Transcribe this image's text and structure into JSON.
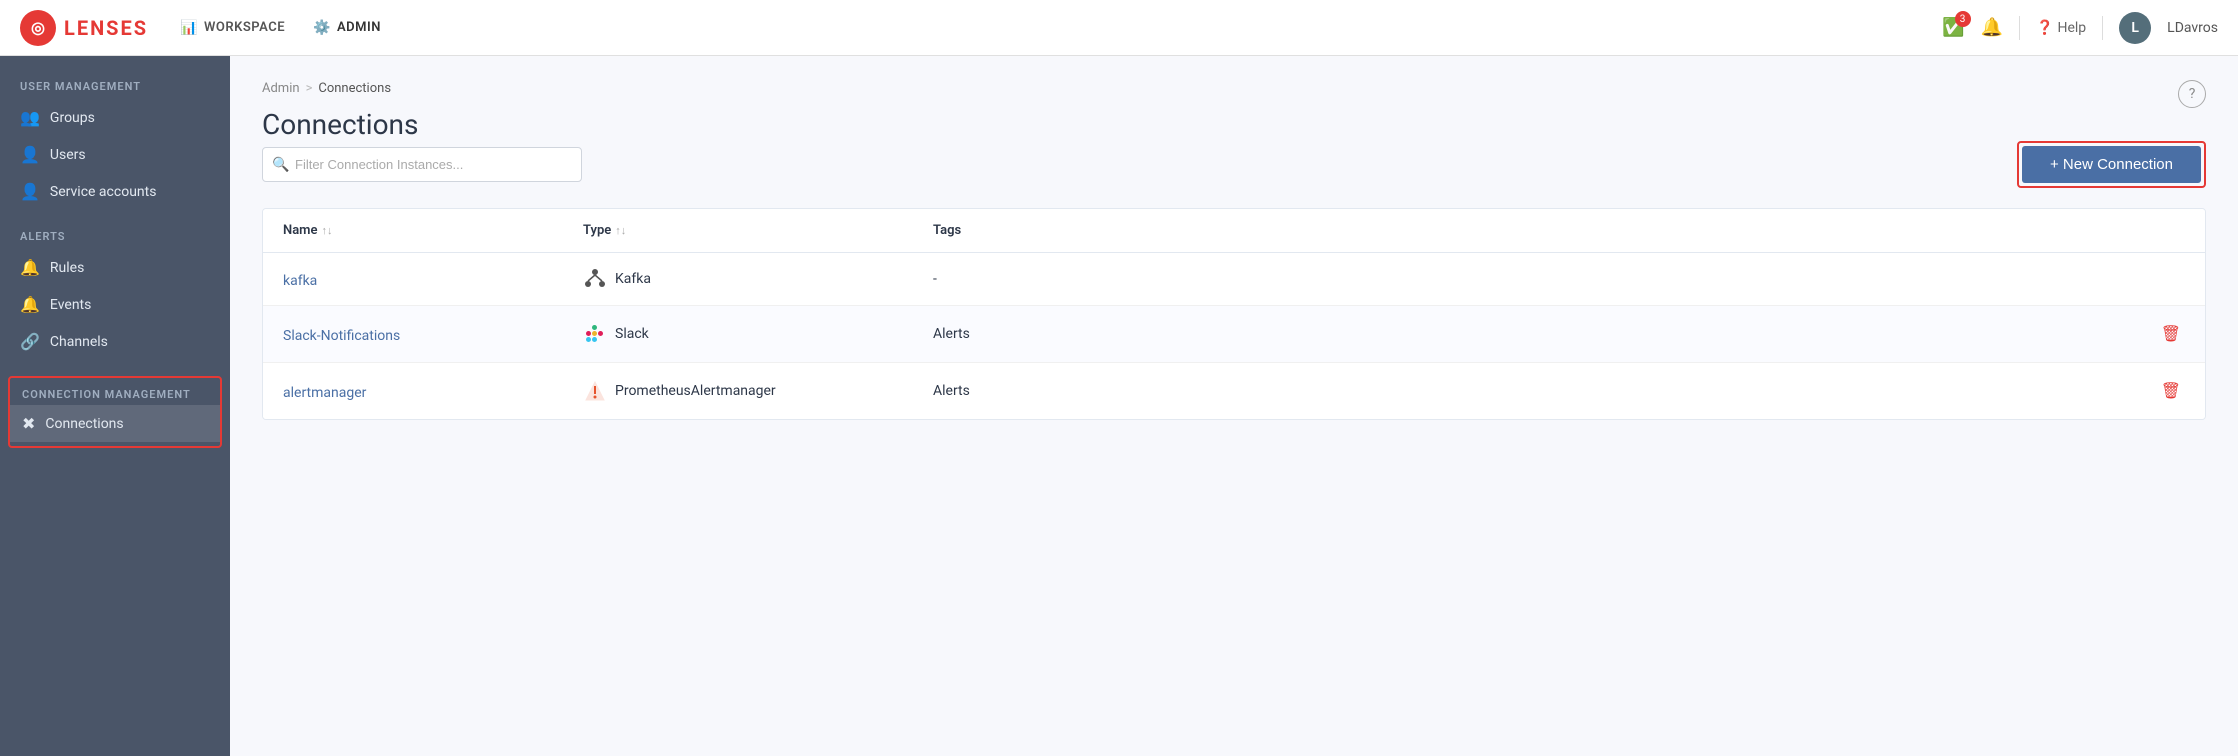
{
  "brand": {
    "logo_initial": "◎",
    "name": "LENSES"
  },
  "topnav": {
    "workspace_label": "WORKSPACE",
    "admin_label": "ADMIN",
    "notifications_count": "3",
    "help_label": "Help",
    "user_initial": "L",
    "user_name": "LDavros"
  },
  "sidebar": {
    "user_management_label": "USER MANAGEMENT",
    "groups_label": "Groups",
    "users_label": "Users",
    "service_accounts_label": "Service accounts",
    "alerts_label": "ALERTS",
    "rules_label": "Rules",
    "events_label": "Events",
    "channels_label": "Channels",
    "connection_management_label": "CONNECTION MANAGEMENT",
    "connections_label": "Connections"
  },
  "breadcrumb": {
    "admin_label": "Admin",
    "separator": ">",
    "current": "Connections"
  },
  "main": {
    "page_title": "Connections",
    "filter_placeholder": "Filter Connection Instances...",
    "new_connection_label": "+ New Connection",
    "help_icon": "?"
  },
  "table": {
    "col_name": "Name",
    "col_type": "Type",
    "col_tags": "Tags",
    "rows": [
      {
        "name": "kafka",
        "type": "Kafka",
        "type_icon": "kafka",
        "tags": "-",
        "deletable": false
      },
      {
        "name": "Slack-Notifications",
        "type": "Slack",
        "type_icon": "slack",
        "tags": "Alerts",
        "deletable": true
      },
      {
        "name": "alertmanager",
        "type": "PrometheusAlertmanager",
        "type_icon": "prometheus",
        "tags": "Alerts",
        "deletable": true
      }
    ]
  }
}
